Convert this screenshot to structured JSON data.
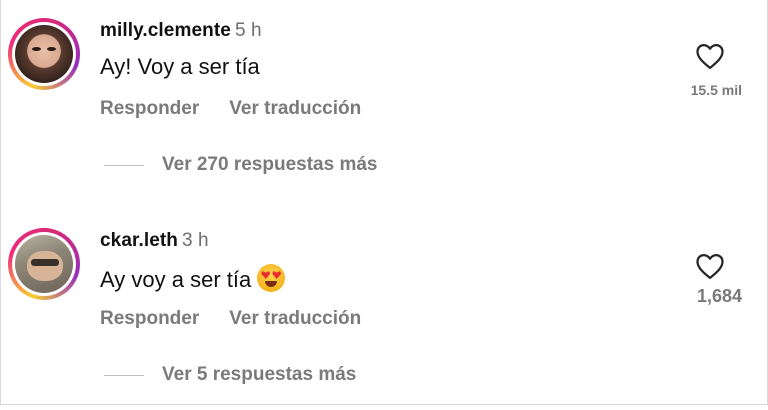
{
  "comments": [
    {
      "username": "milly.clemente",
      "time": "5 h",
      "text": "Ay! Voy a ser tía",
      "emoji": "",
      "reply_label": "Responder",
      "translate_label": "Ver traducción",
      "view_replies": "Ver 270 respuestas más",
      "likes": "15.5 mil"
    },
    {
      "username": "ckar.leth",
      "time": "3 h",
      "text": "Ay voy a ser tía",
      "emoji": "heart-eyes-emoji",
      "reply_label": "Responder",
      "translate_label": "Ver traducción",
      "view_replies": "Ver 5 respuestas más",
      "likes": "1,684"
    }
  ],
  "icons": {
    "like": "heart-outline-icon"
  },
  "colors": {
    "story_ring": [
      "#f9ce34",
      "#ee2a7b",
      "#962fbf"
    ],
    "secondary_text": "#7a7a7a"
  }
}
